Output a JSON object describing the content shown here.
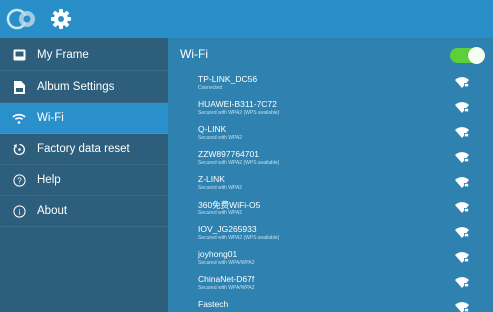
{
  "sidebar": {
    "items": [
      {
        "label": "My Frame",
        "icon": "frame-icon",
        "active": false
      },
      {
        "label": "Album Settings",
        "icon": "album-icon",
        "active": false
      },
      {
        "label": "Wi-Fi",
        "icon": "wifi-icon",
        "active": true
      },
      {
        "label": "Factory data reset",
        "icon": "reset-icon",
        "active": false
      },
      {
        "label": "Help",
        "icon": "help-icon",
        "active": false
      },
      {
        "label": "About",
        "icon": "info-icon",
        "active": false
      }
    ]
  },
  "wifi": {
    "title": "Wi-Fi",
    "enabled": true,
    "networks": [
      {
        "name": "TP-LINK_DC56",
        "status": "Connected"
      },
      {
        "name": "HUAWEI-B311-7C72",
        "status": "Secured with WPA2 (WPS available)"
      },
      {
        "name": "Q-LINK",
        "status": "Secured with WPA2"
      },
      {
        "name": "ZZW897764701",
        "status": "Secured with WPA2 (WPS available)"
      },
      {
        "name": "Z-LINK",
        "status": "Secured with WPA2"
      },
      {
        "name": "360免费WiFi-O5",
        "status": "Secured with WPA2"
      },
      {
        "name": "IOV_JG265933",
        "status": "Secured with WPA2 (WPS available)"
      },
      {
        "name": "joyhong01",
        "status": "Secured with WPA/WPA2"
      },
      {
        "name": "ChinaNet-D67f",
        "status": "Secured with WPA/WPA2"
      },
      {
        "name": "Fastech",
        "status": ""
      }
    ]
  },
  "colors": {
    "topbar": "#2a8fc8",
    "sidebar": "#2d5f7d",
    "active": "#2a90cb",
    "content": "#2f82b0",
    "toggle_on": "#5ccf3a"
  }
}
